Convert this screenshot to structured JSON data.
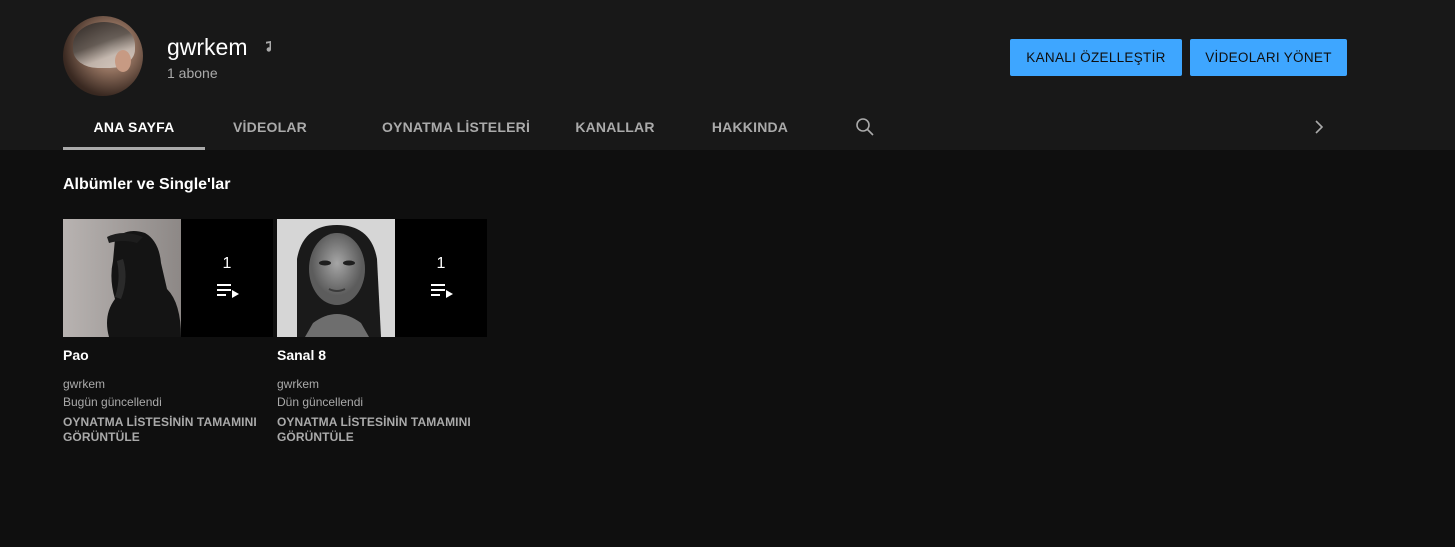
{
  "channel": {
    "name": "gwrkem",
    "subscribers": "1 abone"
  },
  "actions": {
    "customize_label": "KANALI ÖZELLEŞTİR",
    "manage_label": "VİDEOLARI YÖNET"
  },
  "tabs": [
    {
      "label": "ANA SAYFA",
      "active": true
    },
    {
      "label": "VİDEOLAR",
      "active": false
    },
    {
      "label": "OYNATMA LİSTELERİ",
      "active": false
    },
    {
      "label": "KANALLAR",
      "active": false
    },
    {
      "label": "HAKKINDA",
      "active": false
    }
  ],
  "section": {
    "title": "Albümler ve Single'lar"
  },
  "playlists": [
    {
      "title": "Pao",
      "count": "1",
      "author": "gwrkem",
      "updated": "Bugün güncellendi",
      "view_all": "OYNATMA LİSTESİNİN TAMAMINI GÖRÜNTÜLE"
    },
    {
      "title": "Sanal 8",
      "count": "1",
      "author": "gwrkem",
      "updated": "Dün güncellendi",
      "view_all": "OYNATMA LİSTESİNİN TAMAMINI GÖRÜNTÜLE"
    }
  ],
  "icons": {
    "music": "music-note-icon",
    "search": "search-icon",
    "next": "chevron-right-icon",
    "playlist": "playlist-play-icon"
  },
  "colors": {
    "accent": "#3ea6ff",
    "header_bg": "#181818",
    "page_bg": "#0f0f0f",
    "muted_text": "#aaaaaa"
  }
}
